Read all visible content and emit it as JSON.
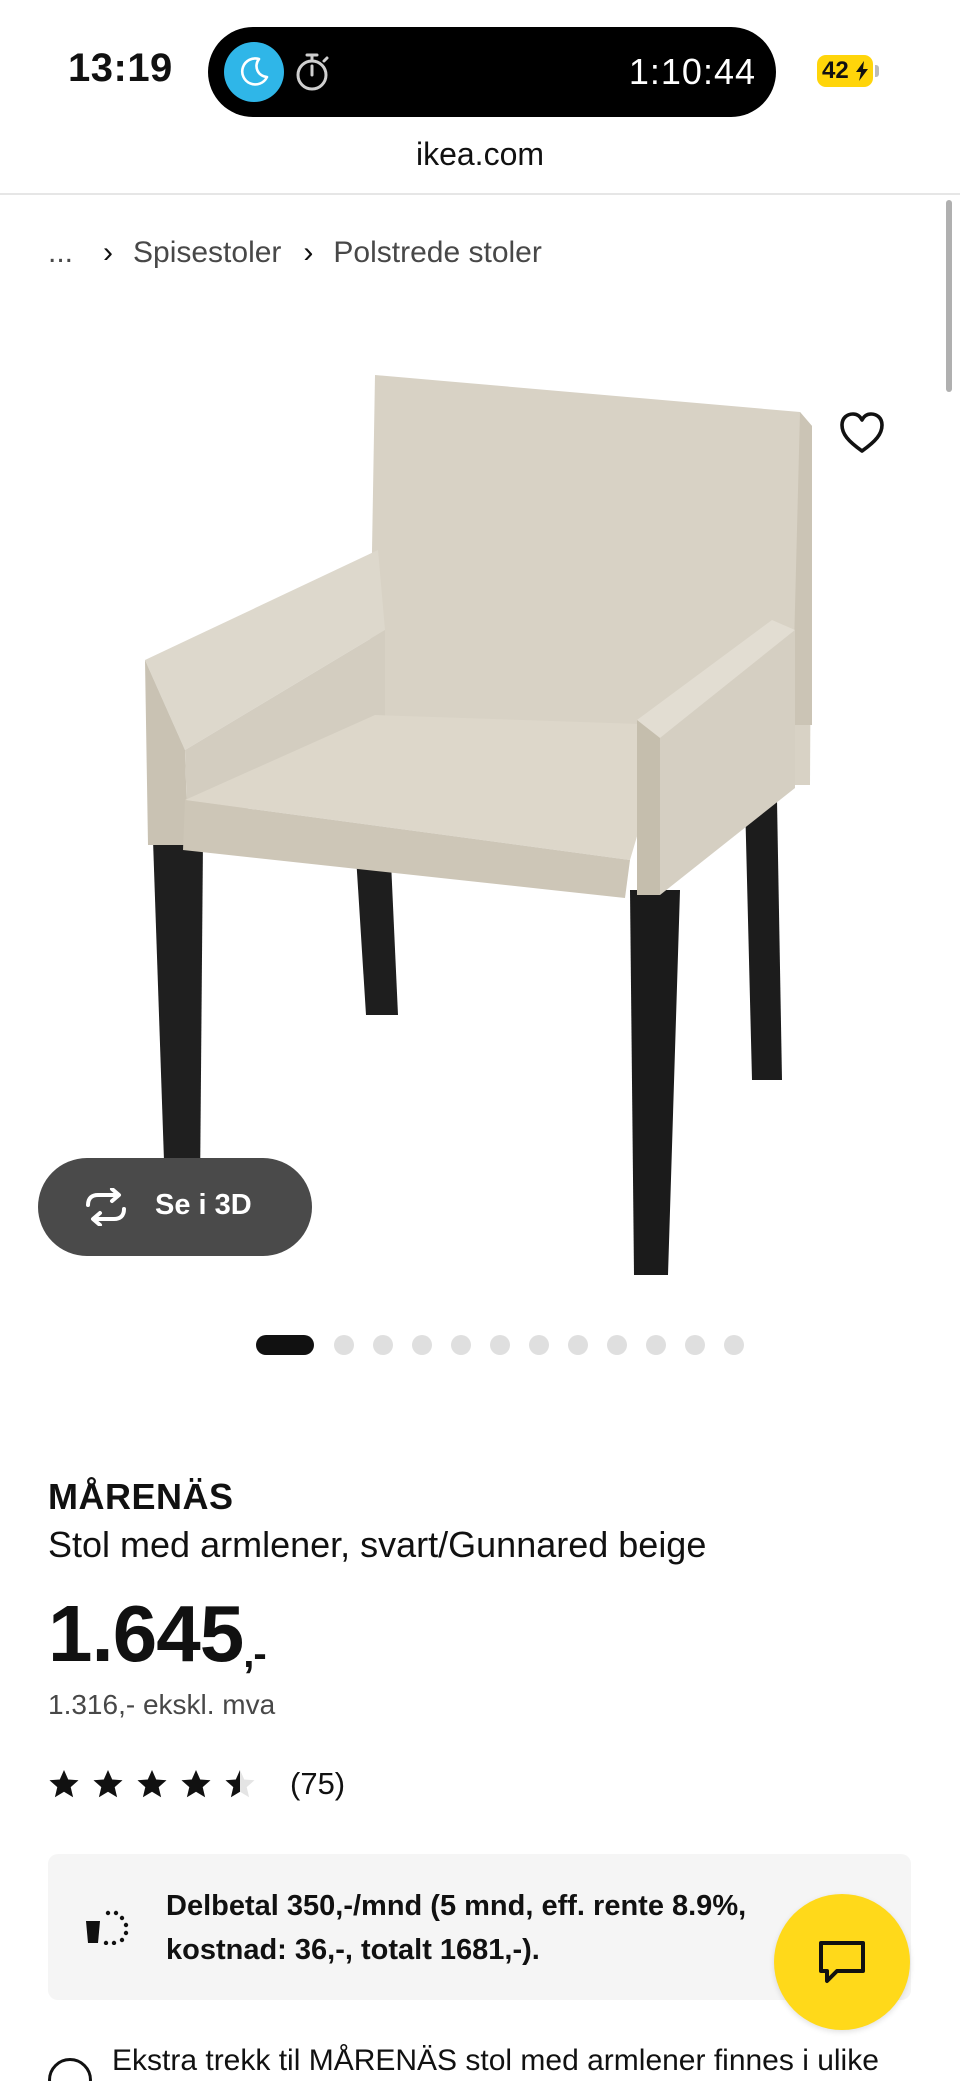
{
  "status_bar": {
    "time": "13:19",
    "timer": "1:10:44",
    "battery": "42",
    "icons": [
      "moon-icon",
      "stopwatch-icon",
      "charging-bolt-icon"
    ]
  },
  "browser": {
    "url": "ikea.com"
  },
  "breadcrumb": {
    "ellipsis": "...",
    "items": [
      "Spisestoler",
      "Polstrede stoler"
    ]
  },
  "gallery": {
    "view_3d_label": "Se i 3D",
    "image_count": 12,
    "active_index": 0,
    "favorite_icon": "heart-icon"
  },
  "product": {
    "name": "MÅRENÄS",
    "description": "Stol med armlener, svart/Gunnared beige",
    "price": "1.645",
    "price_suffix": ",-",
    "price_ex_vat": "1.316,- ekskl. mva",
    "rating_value": 4.5,
    "rating_count": "(75)"
  },
  "finance": {
    "text": "Delbetal 350,-/mnd (5 mnd, eff. rente 8.9%, kostnad: 36,-, totalt 1681,-)."
  },
  "notice": {
    "text": "Ekstra trekk til MÅRENÄS stol med armlener finnes i ulike"
  },
  "colors": {
    "accent_yellow": "#ffd91a",
    "moon_blue": "#2fb6e8",
    "dark_pill": "#4a4a4a"
  }
}
